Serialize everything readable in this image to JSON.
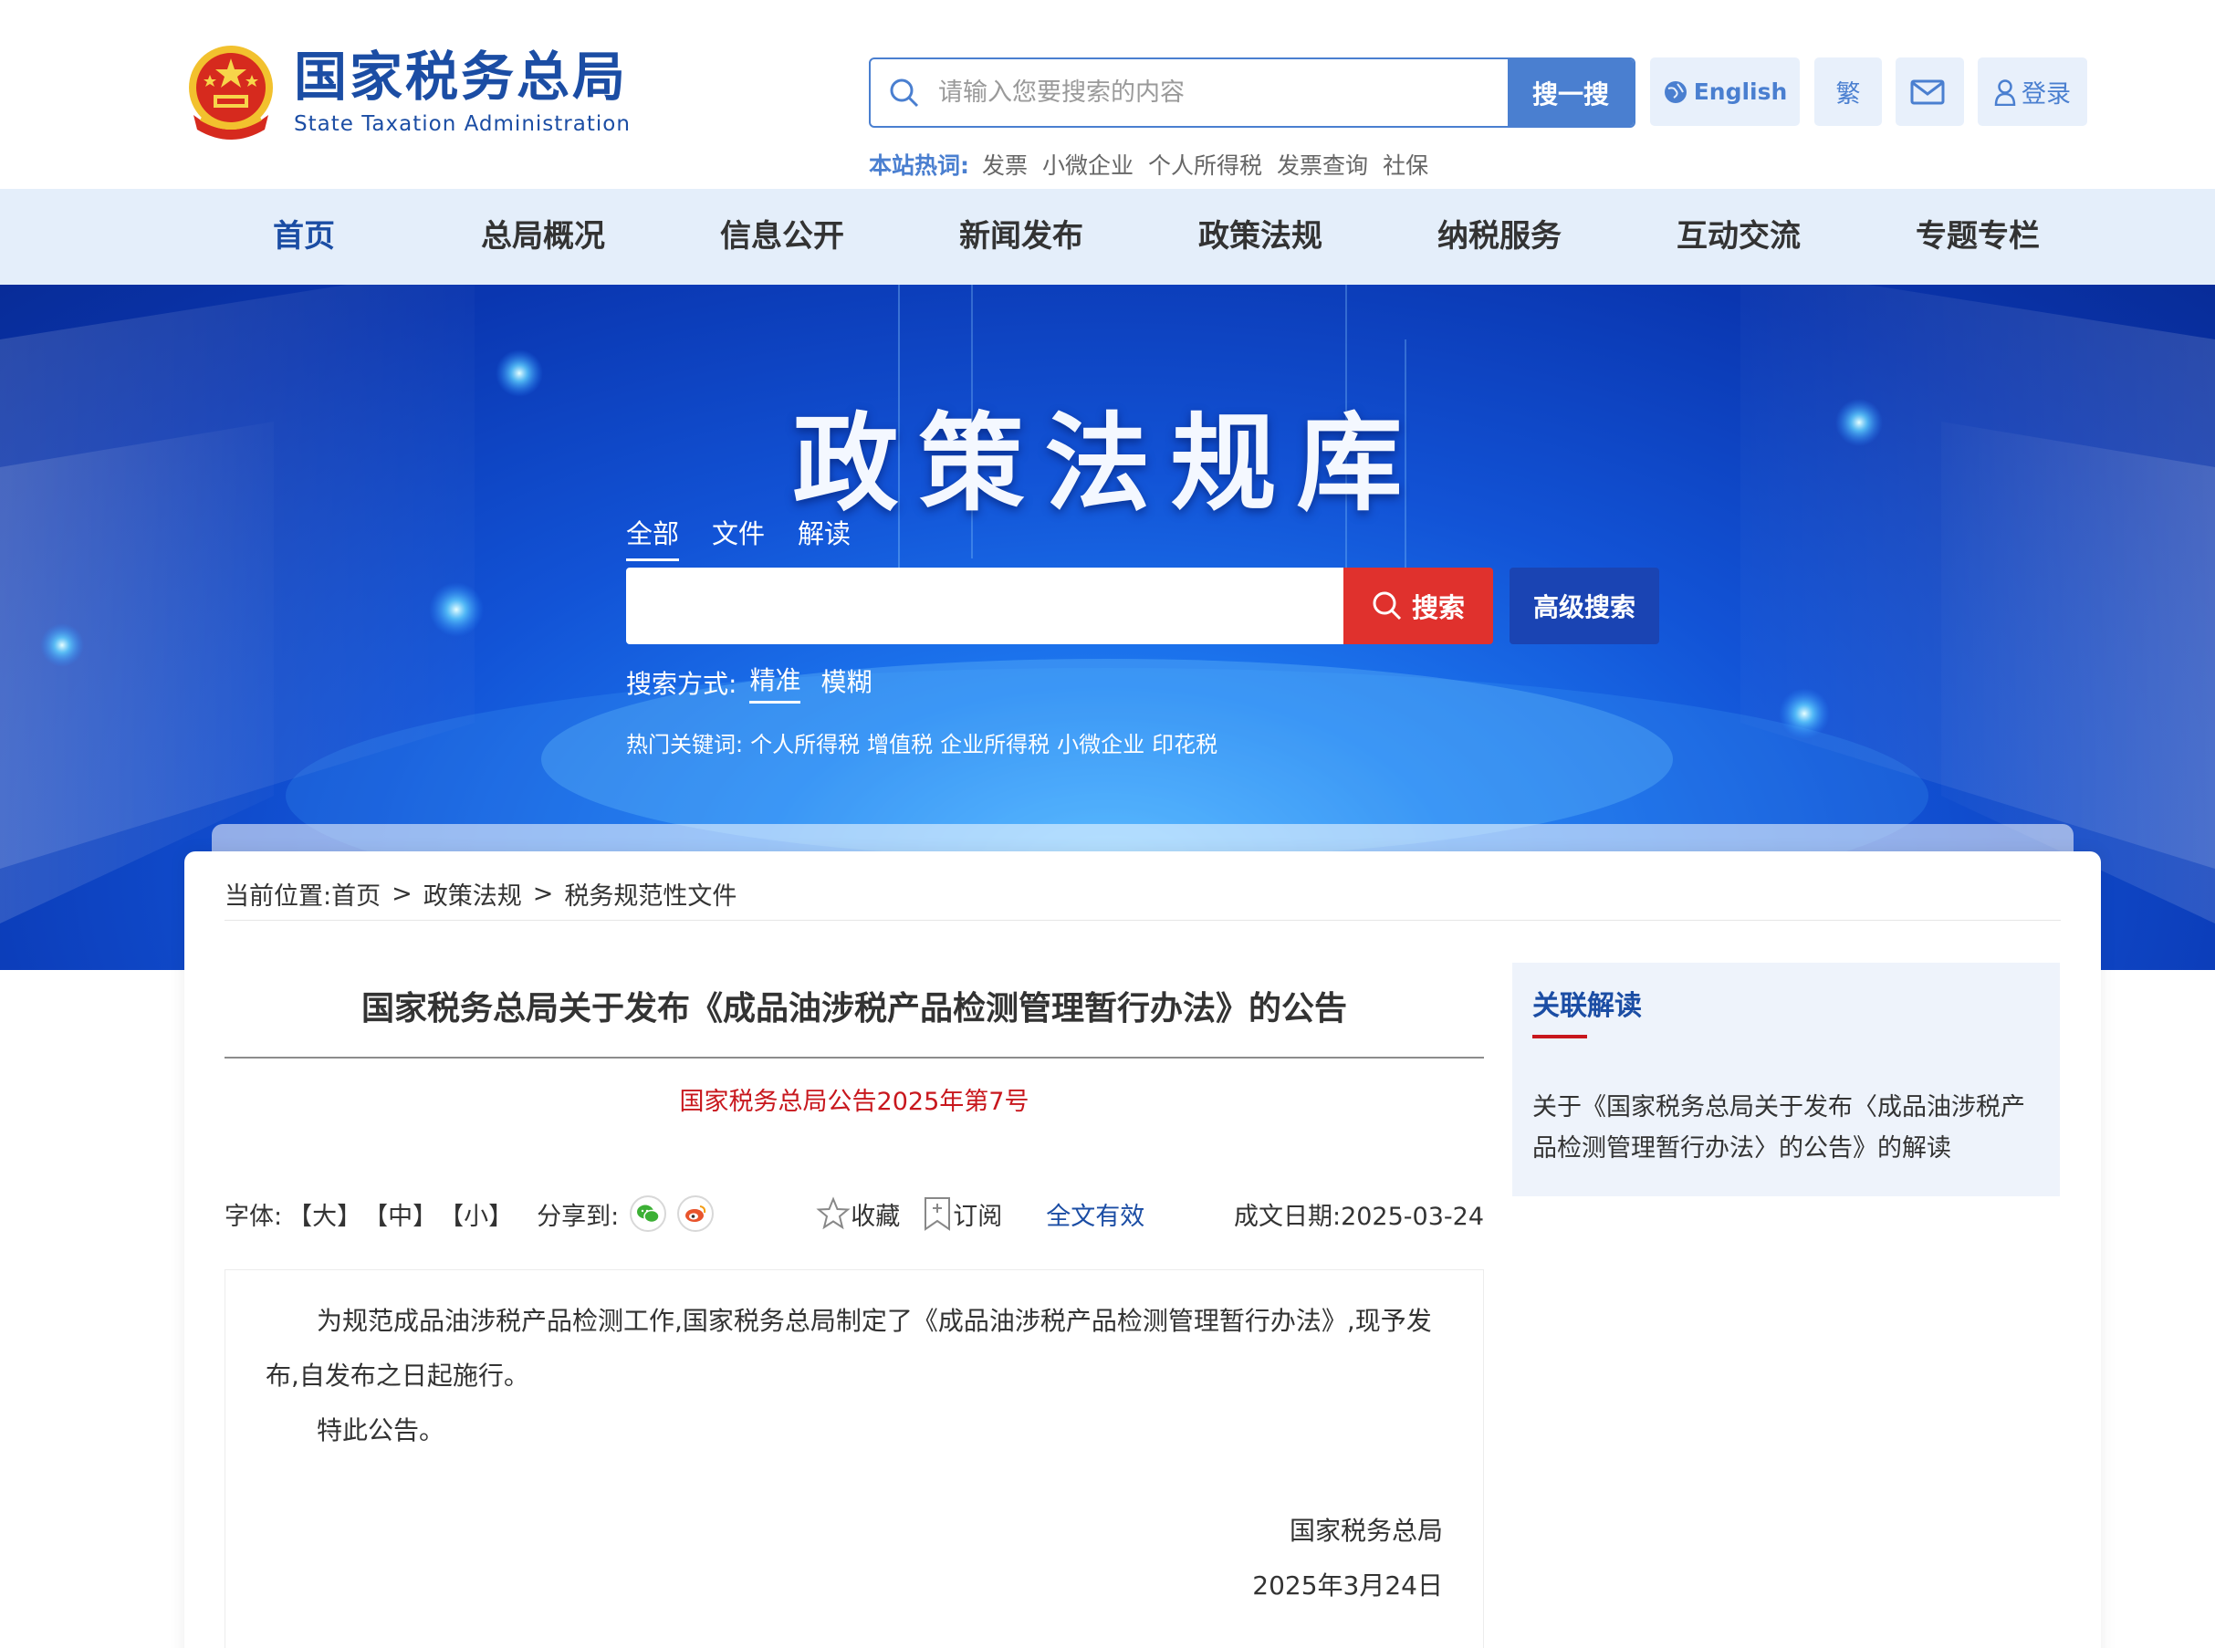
{
  "header": {
    "logo_cn": "国家税务总局",
    "logo_en": "State Taxation Administration",
    "search_placeholder": "请输入您要搜索的内容",
    "search_button": "搜一搜",
    "english_label": "English",
    "traditional_label": "繁",
    "login_label": "登录",
    "hotwords_label": "本站热词:",
    "hotwords": [
      "发票",
      "小微企业",
      "个人所得税",
      "发票查询",
      "社保"
    ]
  },
  "nav": {
    "items": [
      "首页",
      "总局概况",
      "信息公开",
      "新闻发布",
      "政策法规",
      "纳税服务",
      "互动交流",
      "专题专栏"
    ]
  },
  "banner": {
    "title": "政策法规库",
    "tabs": [
      "全部",
      "文件",
      "解读"
    ],
    "search_button": "搜索",
    "advanced_button": "高级搜索",
    "mode_label": "搜索方式:",
    "modes": [
      "精准",
      "模糊"
    ],
    "hot_label": "热门关键词:",
    "hot_keywords": [
      "个人所得税",
      "增值税",
      "企业所得税",
      "小微企业",
      "印花税"
    ]
  },
  "breadcrumb": {
    "label": "当前位置:",
    "items": [
      "首页",
      "政策法规",
      "税务规范性文件"
    ],
    "separator": ">"
  },
  "article": {
    "title": "国家税务总局关于发布《成品油涉税产品检测管理暂行办法》的公告",
    "doc_no": "国家税务总局公告2025年第7号",
    "font_label": "字体:",
    "font_sizes": [
      "【大】",
      "【中】",
      "【小】"
    ],
    "share_label": "分享到:",
    "collect": "收藏",
    "subscribe": "订阅",
    "validity": "全文有效",
    "date": "成文日期:2025-03-24",
    "para1": "为规范成品油涉税产品检测工作,国家税务总局制定了《成品油涉税产品检测管理暂行办法》,现予发布,自发布之日起施行。",
    "para2": "特此公告。",
    "signer": "国家税务总局",
    "sign_date": "2025年3月24日"
  },
  "sidebar": {
    "title": "关联解读",
    "link": "关于《国家税务总局关于发布〈成品油涉税产品检测管理暂行办法〉的公告》的解读"
  },
  "colors": {
    "brand_blue": "#1b4da4",
    "accent_blue": "#4a7fd0",
    "nav_bg": "#e4eefa",
    "red": "#c8171d",
    "search_red": "#e0312d"
  }
}
